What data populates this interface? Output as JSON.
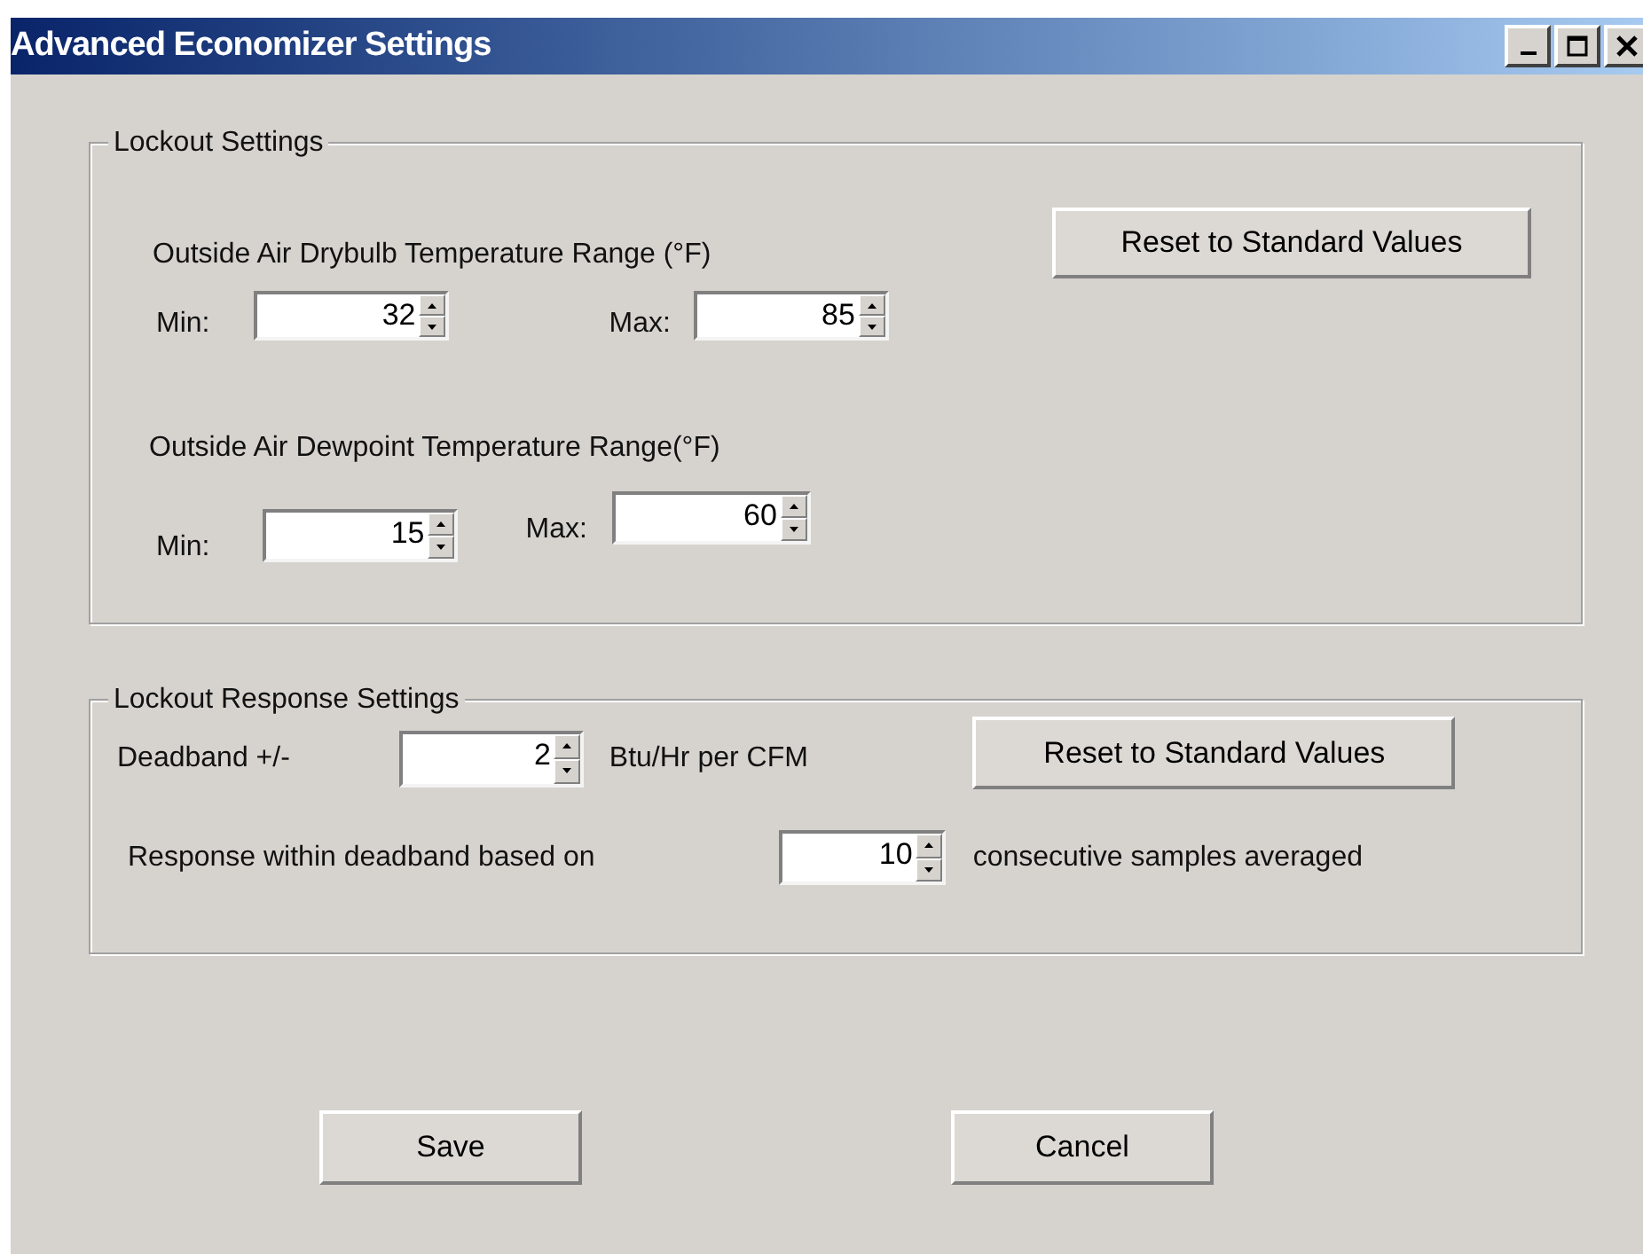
{
  "window": {
    "title": "Advanced Economizer Settings"
  },
  "lockout_settings": {
    "title": "Lockout Settings",
    "reset_button": "Reset to Standard Values",
    "drybulb": {
      "label": "Outside Air Drybulb Temperature Range (°F)",
      "min_label": "Min:",
      "min": "32",
      "max_label": "Max:",
      "max": "85"
    },
    "dewpoint": {
      "label": "Outside Air Dewpoint Temperature Range(°F)",
      "min_label": "Min:",
      "min": "15",
      "max_label": "Max:",
      "max": "60"
    }
  },
  "lockout_response_settings": {
    "title": "Lockout Response Settings",
    "deadband_label": "Deadband +/-",
    "deadband": "2",
    "deadband_unit": "Btu/Hr per CFM",
    "reset_button": "Reset to Standard Values",
    "samples_label": "Response within deadband based on",
    "samples": "10",
    "samples_unit": "consecutive samples averaged"
  },
  "buttons": [
    "Save",
    "Cancel"
  ]
}
